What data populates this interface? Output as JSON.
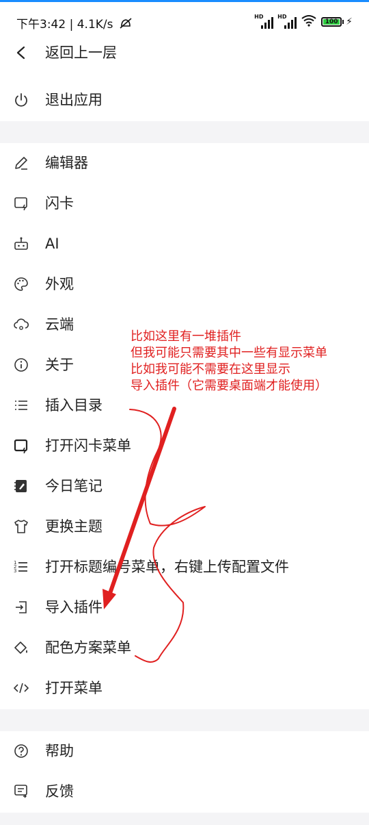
{
  "status_bar": {
    "time": "下午3:42",
    "speed": "4.1K/s",
    "battery": "100",
    "hd1": "HD",
    "hd2": "HD"
  },
  "nav": {
    "back_label": "返回上一层"
  },
  "menu": {
    "exit": "退出应用",
    "editor": "编辑器",
    "flashcard": "闪卡",
    "ai": "AI",
    "appearance": "外观",
    "cloud": "云端",
    "about": "关于",
    "insert_toc": "插入目录",
    "open_flashcard_menu": "打开闪卡菜单",
    "daily_note": "今日笔记",
    "change_theme": "更换主题",
    "heading_numbering": "打开标题编号菜单，右键上传配置文件",
    "import_plugin": "导入插件",
    "color_scheme_menu": "配色方案菜单",
    "open_menu": "打开菜单",
    "help": "帮助",
    "feedback": "反馈"
  },
  "annotation": {
    "line1": "比如这里有一堆插件",
    "line2": "但我可能只需要其中一些有显示菜单",
    "line3": "比如我可能不需要在这里显示",
    "line4": "导入插件（它需要桌面端才能使用）",
    "color": "#e02020"
  }
}
